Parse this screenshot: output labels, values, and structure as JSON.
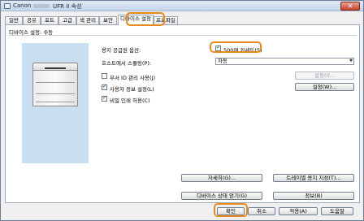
{
  "window": {
    "title": "Canon",
    "title_suffix": "UFR II 속성",
    "close_glyph": "✕"
  },
  "tabs": [
    {
      "label": "일반"
    },
    {
      "label": "공유"
    },
    {
      "label": "포트"
    },
    {
      "label": "고급"
    },
    {
      "label": "색 관리"
    },
    {
      "label": "보안"
    },
    {
      "label": "디바이스 설정",
      "active": true
    },
    {
      "label": "프로파일"
    }
  ],
  "device_settings": {
    "section_label": "디바이스 설정: 수동",
    "paper_source_options_label": "용지 공급원 옵션:",
    "cassette_option": {
      "label": "500매 카세트(5)",
      "checked": true
    },
    "spooling_label": "호스트에서 스풀링(P):",
    "spooling_value": "자동",
    "dept_id_label": "부서 ID 관리 사용(J)",
    "dept_id_checked": false,
    "user_info_label": "사용자 정보 설정(L)",
    "user_info_checked": true,
    "secure_print_label": "비밀 인쇄 허용(C)",
    "secure_print_checked": true,
    "settings_button": "설정(I)...",
    "user_settings_button": "설정(W)...",
    "details_button": "자세히(G)...",
    "tray_paper_button": "트레이별 용지 지정(T)...",
    "get_status_button": "디바이스 상태 얻기(G)",
    "info_button": "정보(B)"
  },
  "footer": {
    "ok": "확인",
    "cancel": "취소",
    "apply": "적용(A)",
    "help": "도움말"
  },
  "colors": {
    "highlight": "#e8891f",
    "preview_bg": "#c9def1"
  }
}
